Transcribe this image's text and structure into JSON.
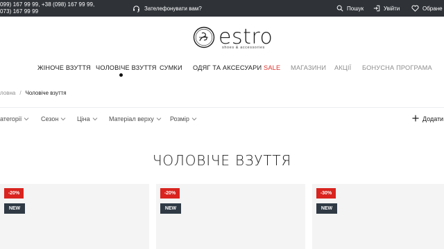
{
  "topbar": {
    "phones_line1": "099) 167 99 99, +38 (098) 167 99 99,",
    "phones_line2": "073) 167 99 99",
    "callback_label": "Зателефонувати вам?",
    "search_label": "Пошук",
    "login_label": "Увійти",
    "favorites_label": "Обране",
    "icons": [
      "headset-icon",
      "search-icon",
      "login-icon",
      "heart-icon"
    ]
  },
  "logo": {
    "brand": "estro",
    "tagline": "shoes & accessories"
  },
  "nav": {
    "items": [
      {
        "label": "ЖІНОЧЕ ВЗУТТЯ"
      },
      {
        "label": "ЧОЛОВІЧЕ ВЗУТТЯ",
        "active": true
      },
      {
        "label": "СУМКИ"
      },
      {
        "label": "ОДЯГ ТА АКСЕСУАРИ"
      },
      {
        "label": "SALE"
      },
      {
        "label": "МАГАЗИНИ"
      },
      {
        "label": "АКЦІЇ"
      },
      {
        "label": "БОНУСНА ПРОГРАМА"
      }
    ]
  },
  "breadcrumb": {
    "home": "ловна",
    "separator": "/",
    "current": "Чоловіче взуття"
  },
  "filters": {
    "items": [
      {
        "label": "атегорії"
      },
      {
        "label": "Сезон"
      },
      {
        "label": "Ціна"
      },
      {
        "label": "Матеріал верху"
      },
      {
        "label": "Розмір"
      }
    ],
    "add_label": "Додати"
  },
  "main": {
    "title": "ЧОЛОВІЧЕ ВЗУТТЯ"
  },
  "products": [
    {
      "discount": "-20%",
      "tag": "NEW"
    },
    {
      "discount": "-20%",
      "tag": "NEW"
    },
    {
      "discount": "-30%",
      "tag": "NEW"
    }
  ],
  "colors": {
    "topbar_bg": "#2f3338",
    "sale": "#e0312b",
    "discount_badge": "#d9241f",
    "new_badge": "#2f3a45",
    "card_bg": "#f4f4f4"
  }
}
